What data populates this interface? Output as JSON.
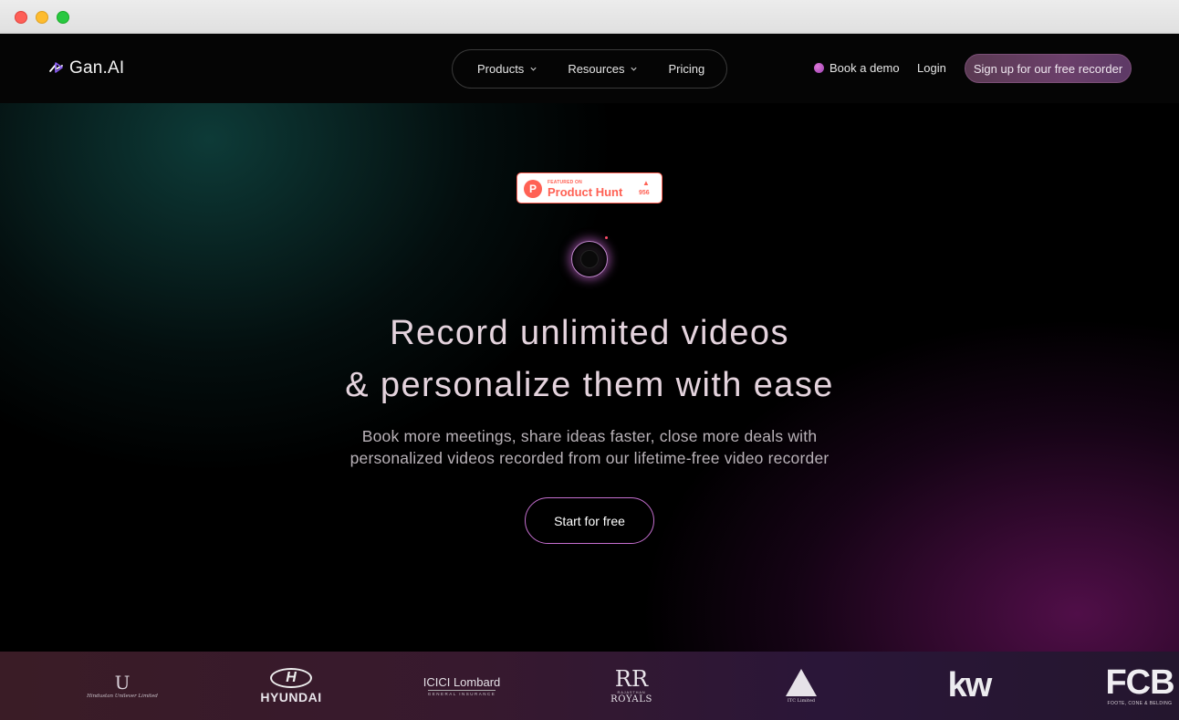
{
  "brand": {
    "name": "Gan.AI",
    "logo_icon": "gan-ai-logo-icon"
  },
  "nav": {
    "items": [
      {
        "label": "Products",
        "has_dropdown": true
      },
      {
        "label": "Resources",
        "has_dropdown": true
      },
      {
        "label": "Pricing",
        "has_dropdown": false
      }
    ],
    "book_demo": "Book a demo",
    "login": "Login",
    "signup": "Sign up for our free recorder"
  },
  "product_hunt": {
    "featured": "FEATURED ON",
    "name": "Product Hunt",
    "letter": "P",
    "upvotes": "956",
    "color": "#ff6154"
  },
  "hero": {
    "headline_line1": "Record unlimited videos",
    "headline_line2": "& personalize them with ease",
    "sub_line1": "Book more meetings, share ideas faster, close more deals with",
    "sub_line2": "personalized videos recorded from our lifetime-free video recorder",
    "cta": "Start for free"
  },
  "client_logos": [
    {
      "name": "Hindustan Unilever Limited",
      "mark": "U",
      "caption": "Hindustan Unilever Limited"
    },
    {
      "name": "Hyundai",
      "mark": "H",
      "caption": "HYUNDAI"
    },
    {
      "name": "ICICI Lombard",
      "caption": "ICICI Lombard",
      "sub": "GENERAL INSURANCE"
    },
    {
      "name": "Rajasthan Royals",
      "mark": "RR",
      "sub": "RAJASTHAN",
      "caption": "ROYALS"
    },
    {
      "name": "ITC Limited",
      "caption": "ITC Limited"
    },
    {
      "name": "kw",
      "caption": "kw"
    },
    {
      "name": "FCB",
      "caption": "FCB",
      "sub": "FOOTE, CONE & BELDING"
    }
  ],
  "colors": {
    "accent_pink": "#c56fd0",
    "signup_bg": "#6b3f6a",
    "background": "#000000"
  }
}
